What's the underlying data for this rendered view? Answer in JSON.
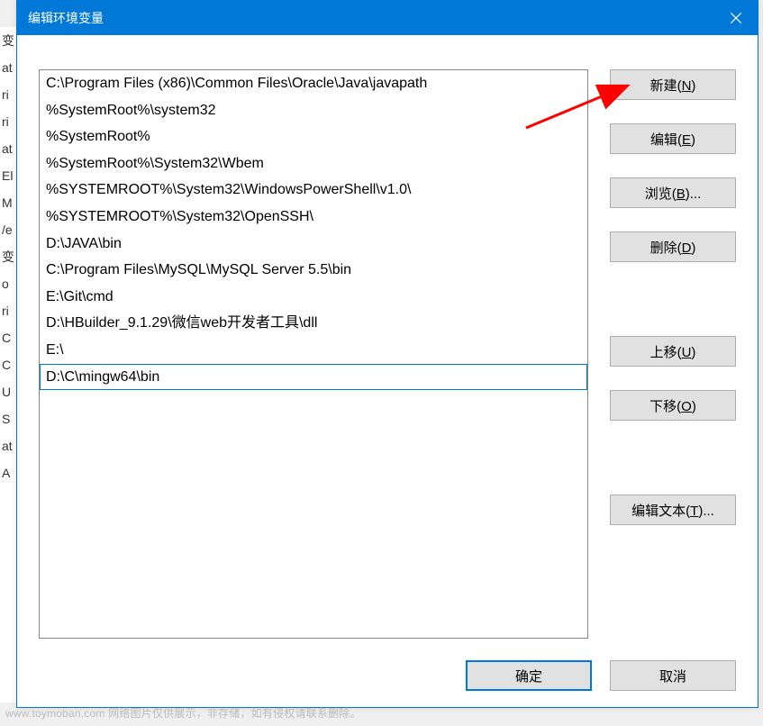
{
  "titlebar": {
    "title": "编辑环境变量"
  },
  "paths": [
    {
      "value": "C:\\Program Files (x86)\\Common Files\\Oracle\\Java\\javapath",
      "selected": false
    },
    {
      "value": "%SystemRoot%\\system32",
      "selected": false
    },
    {
      "value": "%SystemRoot%",
      "selected": false
    },
    {
      "value": "%SystemRoot%\\System32\\Wbem",
      "selected": false
    },
    {
      "value": "%SYSTEMROOT%\\System32\\WindowsPowerShell\\v1.0\\",
      "selected": false
    },
    {
      "value": "%SYSTEMROOT%\\System32\\OpenSSH\\",
      "selected": false
    },
    {
      "value": "D:\\JAVA\\bin",
      "selected": false
    },
    {
      "value": "C:\\Program Files\\MySQL\\MySQL Server 5.5\\bin",
      "selected": false
    },
    {
      "value": "E:\\Git\\cmd",
      "selected": false
    },
    {
      "value": "D:\\HBuilder_9.1.29\\微信web开发者工具\\dll",
      "selected": false
    },
    {
      "value": "E:\\",
      "selected": false
    },
    {
      "value": "D:\\C\\mingw64\\bin",
      "selected": true
    }
  ],
  "buttons": {
    "new_label": "新建(",
    "new_key": "N",
    "edit_label": "编辑(",
    "edit_key": "E",
    "browse_label": "浏览(",
    "browse_key": "B",
    "browse_suffix": ")...",
    "delete_label": "删除(",
    "delete_key": "D",
    "moveup_label": "上移(",
    "moveup_key": "U",
    "movedown_label": "下移(",
    "movedown_key": "O",
    "edittext_label": "编辑文本(",
    "edittext_key": "T",
    "edittext_suffix": ")...",
    "close_paren": ")",
    "ok_label": "确定",
    "cancel_label": "取消"
  },
  "arrow": {
    "color": "#ff0000"
  },
  "watermark": "www.toymoban.com 网络图片仅供展示，非存储，如有侵权请联系删除。",
  "bg_fragments": [
    "变",
    "at",
    "ri",
    "ri",
    "at",
    "El",
    "M",
    "/e",
    "",
    "",
    "变",
    "o",
    "ri",
    "C",
    "C",
    "U",
    "S",
    "at",
    "A"
  ]
}
